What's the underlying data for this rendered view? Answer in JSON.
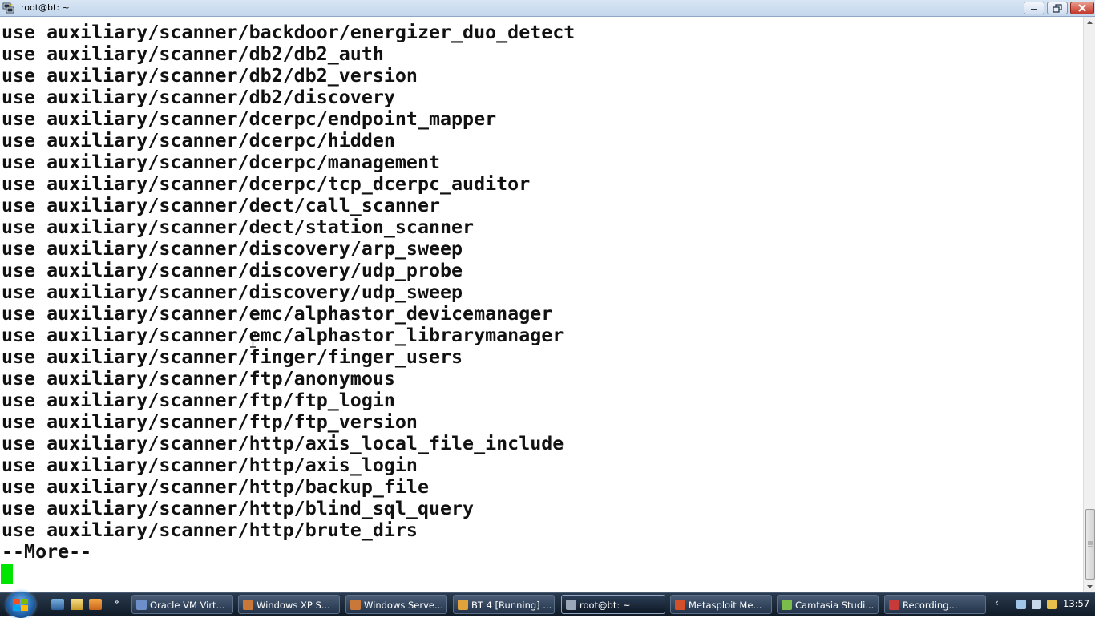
{
  "window": {
    "title": "root@bt: ~"
  },
  "terminal": {
    "lines": [
      "use auxiliary/scanner/backdoor/energizer_duo_detect",
      "use auxiliary/scanner/db2/db2_auth",
      "use auxiliary/scanner/db2/db2_version",
      "use auxiliary/scanner/db2/discovery",
      "use auxiliary/scanner/dcerpc/endpoint_mapper",
      "use auxiliary/scanner/dcerpc/hidden",
      "use auxiliary/scanner/dcerpc/management",
      "use auxiliary/scanner/dcerpc/tcp_dcerpc_auditor",
      "use auxiliary/scanner/dect/call_scanner",
      "use auxiliary/scanner/dect/station_scanner",
      "use auxiliary/scanner/discovery/arp_sweep",
      "use auxiliary/scanner/discovery/udp_probe",
      "use auxiliary/scanner/discovery/udp_sweep",
      "use auxiliary/scanner/emc/alphastor_devicemanager",
      "use auxiliary/scanner/emc/alphastor_librarymanager",
      "use auxiliary/scanner/finger/finger_users",
      "use auxiliary/scanner/ftp/anonymous",
      "use auxiliary/scanner/ftp/ftp_login",
      "use auxiliary/scanner/ftp/ftp_version",
      "use auxiliary/scanner/http/axis_local_file_include",
      "use auxiliary/scanner/http/axis_login",
      "use auxiliary/scanner/http/backup_file",
      "use auxiliary/scanner/http/blind_sql_query",
      "use auxiliary/scanner/http/brute_dirs"
    ],
    "pager_prompt": "--More--",
    "cursor_color": "#00e600"
  },
  "taskbar": {
    "items": [
      {
        "label": "Oracle VM Virt...",
        "icon": "virtualbox-icon",
        "color": "#6d8fc9"
      },
      {
        "label": "Windows XP S...",
        "icon": "vm-window-icon",
        "color": "#c9783a"
      },
      {
        "label": "Windows Serve...",
        "icon": "vm-window-icon",
        "color": "#c9783a"
      },
      {
        "label": "BT 4 [Running] ...",
        "icon": "vm-window-icon",
        "color": "#e0a23a"
      },
      {
        "label": "root@bt: ~",
        "icon": "putty-icon",
        "color": "#9aa7b8"
      },
      {
        "label": "Metasploit Me...",
        "icon": "powerpoint-icon",
        "color": "#d4502a"
      },
      {
        "label": "Camtasia Studi...",
        "icon": "camtasia-icon",
        "color": "#7bbd4a"
      },
      {
        "label": "Recording...",
        "icon": "recording-icon",
        "color": "#c73a3a"
      }
    ],
    "clock": "13:57",
    "tray_icons": [
      "network-icon",
      "volume-icon",
      "shield-icon"
    ]
  }
}
